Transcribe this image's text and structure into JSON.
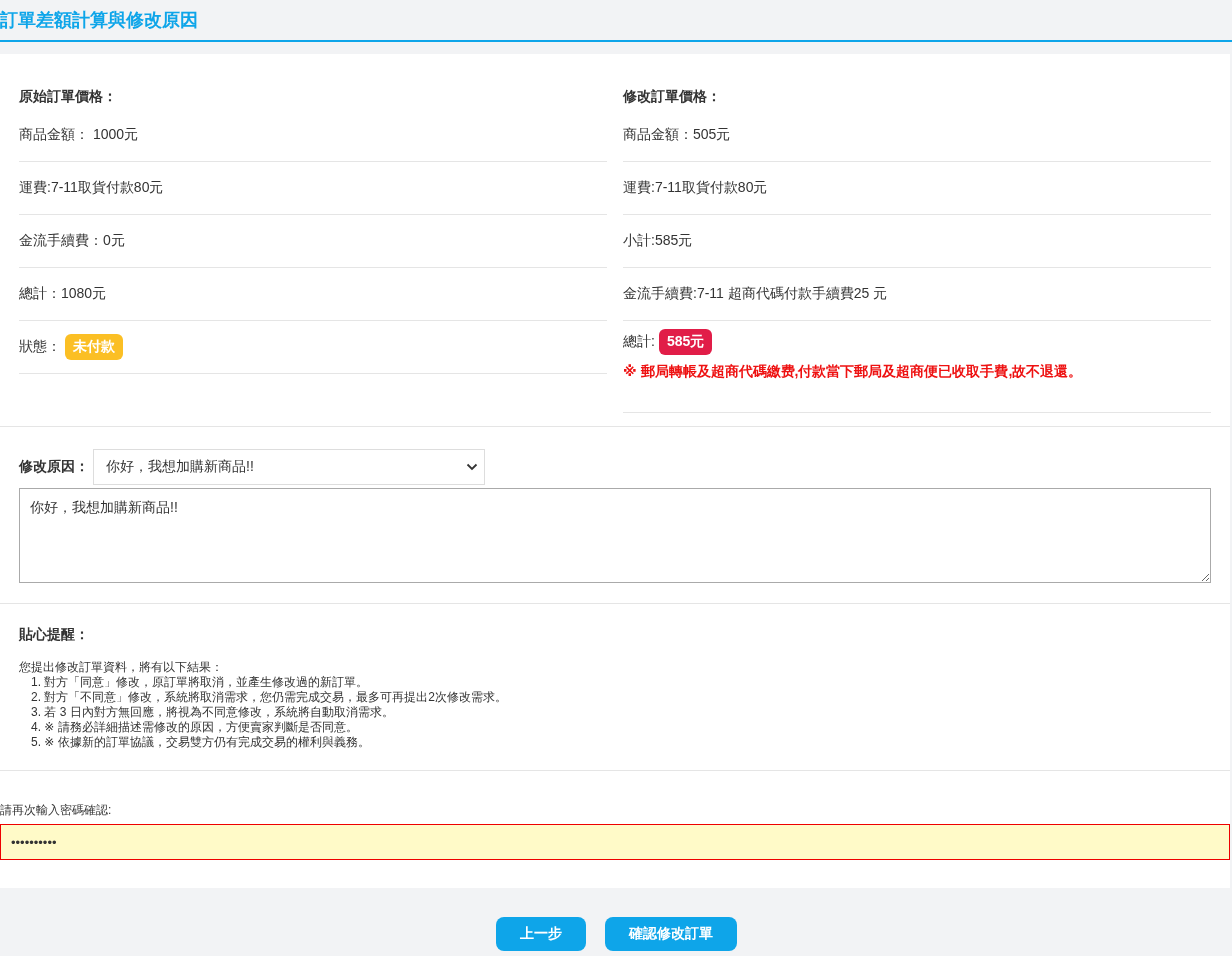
{
  "title": "訂單差額計算與修改原因",
  "columns": [
    {
      "heading": "原始訂單價格：",
      "rows": [
        {
          "kind": "text",
          "text": "商品金額： 1000元"
        },
        {
          "kind": "text",
          "text": "運費:7-11取貨付款80元"
        },
        {
          "kind": "text",
          "text": "金流手續費：0元"
        },
        {
          "kind": "text",
          "text": "總計：1080元"
        },
        {
          "kind": "badge",
          "text": "狀態：",
          "badge": "未付款",
          "color": "#fbbf24"
        }
      ]
    },
    {
      "heading": "修改訂單價格：",
      "rows": [
        {
          "kind": "text",
          "text": "商品金額：505元"
        },
        {
          "kind": "text",
          "text": "運費:7-11取貨付款80元"
        },
        {
          "kind": "text",
          "text": "小計:585元"
        },
        {
          "kind": "text",
          "text": "金流手續費:7-11 超商代碼付款手續費25 元"
        },
        {
          "kind": "badge",
          "text": "總計:",
          "badge": "585元",
          "color": "#e11d48",
          "note": "※ 郵局轉帳及超商代碼繳费,付款當下郵局及超商便已收取手費,故不退還。"
        }
      ]
    }
  ],
  "reason": {
    "label": "修改原因：",
    "selected_option": "你好，我想加購新商品!!",
    "value": "你好，我想加購新商品!!"
  },
  "reminder": {
    "heading": "貼心提醒：",
    "intro": "您提出修改訂單資料，將有以下結果：",
    "items": [
      "1. 對方「同意」修改，原訂單將取消，並產生修改過的新訂單。",
      "2. 對方「不同意」修改，系統將取消需求，您仍需完成交易，最多可再提出2次修改需求。",
      "3. 若 3 日內對方無回應，將視為不同意修改，系統將自動取消需求。",
      "4. ※ 請務必詳細描述需修改的原因，方便賣家判斷是否同意。",
      "5. ※ 依據新的訂單協議，交易雙方仍有完成交易的權利與義務。"
    ]
  },
  "password": {
    "label": "請再次輸入密碼確認:",
    "value": "••••••••••"
  },
  "buttons": [
    "上一步",
    "確認修改訂單"
  ]
}
